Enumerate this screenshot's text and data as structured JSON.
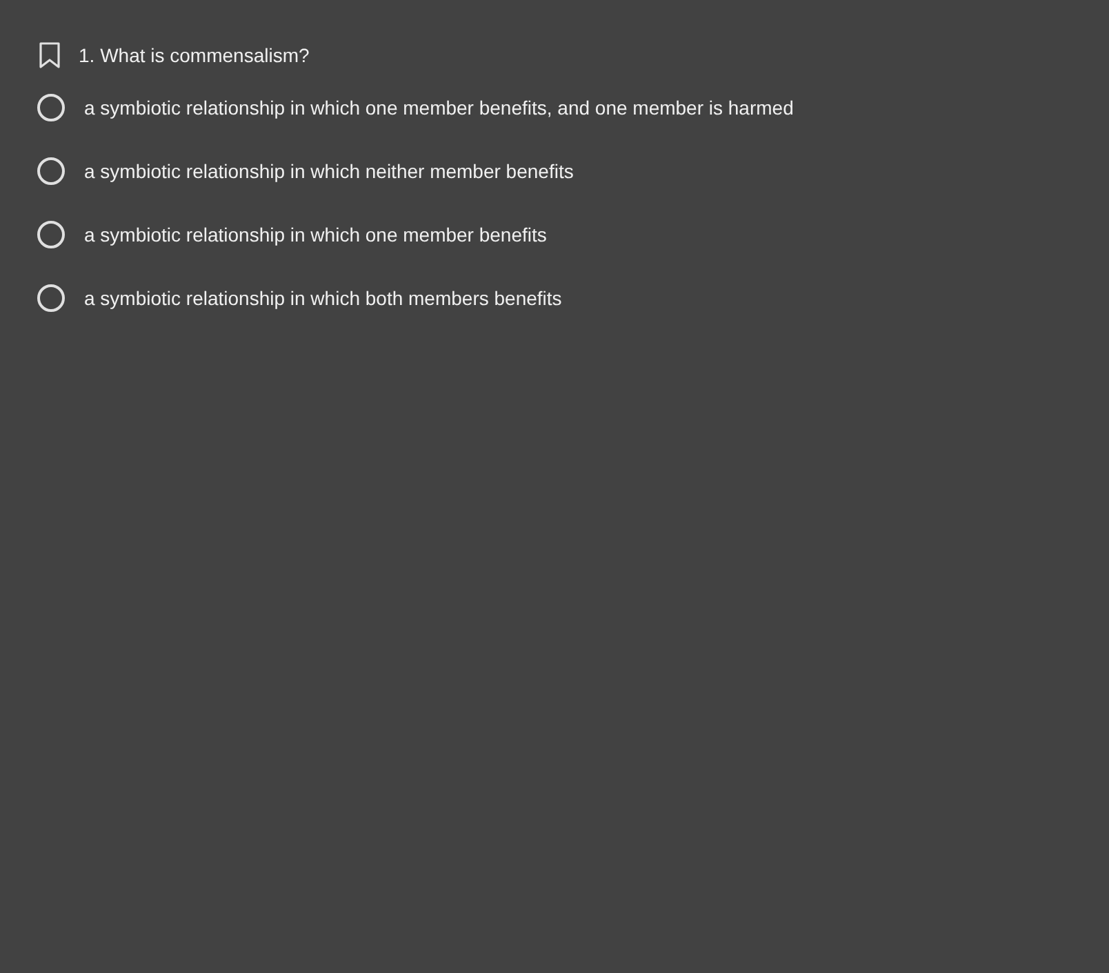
{
  "question": {
    "text": "1. What is commensalism?",
    "bookmarked": false
  },
  "options": [
    {
      "text": "a symbiotic relationship in which one member benefits, and one member is harmed",
      "selected": false
    },
    {
      "text": "a symbiotic relationship in which neither member benefits",
      "selected": false
    },
    {
      "text": "a symbiotic relationship in which one member benefits",
      "selected": false
    },
    {
      "text": "a symbiotic relationship in which both members benefits",
      "selected": false
    }
  ]
}
